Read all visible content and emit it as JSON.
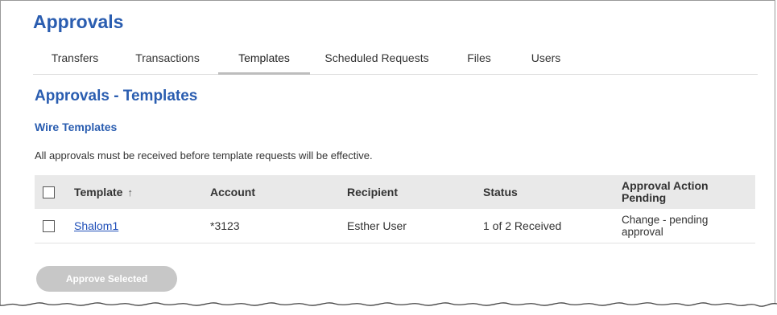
{
  "page": {
    "title": "Approvals"
  },
  "tabs": [
    {
      "label": "Transfers",
      "active": false
    },
    {
      "label": "Transactions",
      "active": false
    },
    {
      "label": "Templates",
      "active": true
    },
    {
      "label": "Scheduled Requests",
      "active": false
    },
    {
      "label": "Files",
      "active": false
    },
    {
      "label": "Users",
      "active": false
    }
  ],
  "section": {
    "title": "Approvals - Templates",
    "subtitle": "Wire Templates",
    "notice": "All approvals must be received before template requests will be effective."
  },
  "table": {
    "headers": {
      "template": "Template",
      "template_sort_icon": "↑",
      "account": "Account",
      "recipient": "Recipient",
      "status": "Status",
      "approval_action": "Approval Action Pending"
    },
    "rows": [
      {
        "template": "Shalom1",
        "account": "*3123",
        "recipient": "Esther User",
        "status": "1 of 2 Received",
        "approval_action": "Change - pending approval"
      }
    ]
  },
  "actions": {
    "approve_selected": "Approve Selected"
  },
  "colors": {
    "brand_blue": "#2a5db0",
    "link_blue": "#1f4fb8",
    "header_bg": "#e9e9e9",
    "button_disabled": "#c7c7c7"
  }
}
